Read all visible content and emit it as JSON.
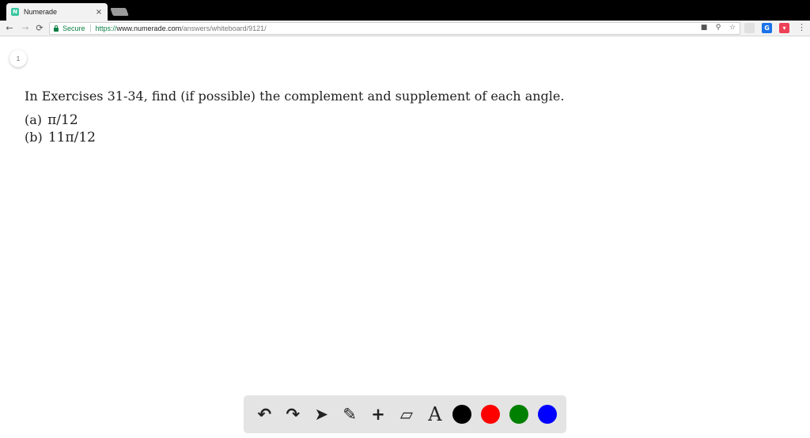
{
  "browser": {
    "tab": {
      "favicon": "N",
      "title": "Numerade",
      "close": "×"
    },
    "nav": {
      "back": "←",
      "forward": "→",
      "reload": "⟳"
    },
    "address": {
      "security": "Secure",
      "scheme": "https://",
      "host": "www.numerade.com",
      "path": "/answers/whiteboard/9121/"
    },
    "icons": {
      "camera": "■",
      "zoom": "⚲",
      "star": "☆"
    },
    "extensions": {
      "g": "G",
      "pocket": "▾"
    },
    "menu": "⋮"
  },
  "page": {
    "page_number": "1",
    "question": "In Exercises 31-34, find (if possible) the complement and supplement of each angle.",
    "parts": [
      {
        "label": "(a)",
        "value": "π/12"
      },
      {
        "label": "(b)",
        "value": "11π/12"
      }
    ]
  },
  "tools": {
    "undo": "↶",
    "redo": "↷",
    "select": "➤",
    "pen": "✎",
    "add": "+",
    "eraser": "▱",
    "text": "A",
    "colors": [
      "#000000",
      "#ff0000",
      "#008000",
      "#0000ff"
    ]
  }
}
